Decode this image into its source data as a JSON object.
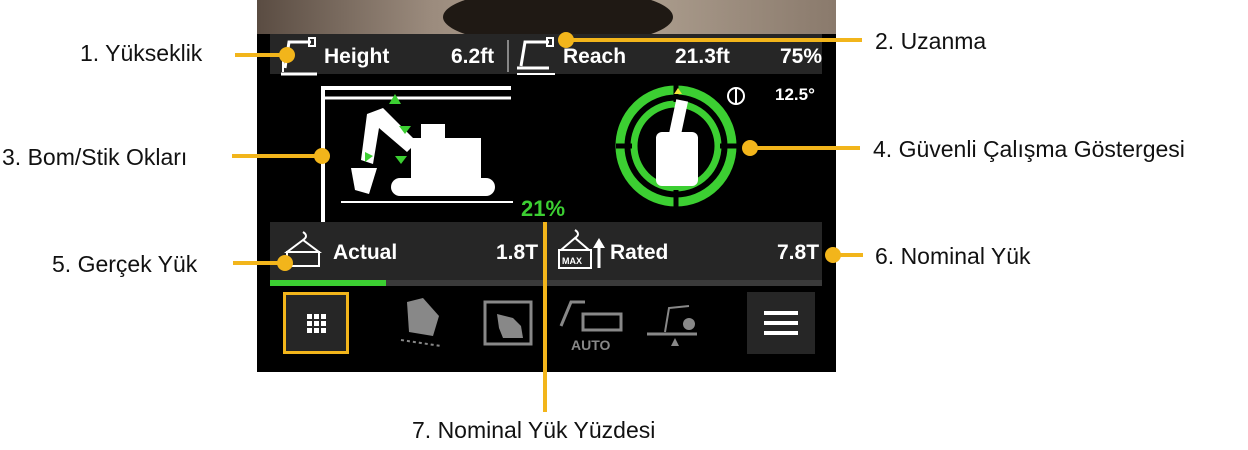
{
  "top_bar": {
    "height_label": "Height",
    "height_value": "6.2ft",
    "reach_label": "Reach",
    "reach_value": "21.3ft",
    "percent": "75%"
  },
  "gauge": {
    "angle": "12.5°"
  },
  "rated_percent_display": "21%",
  "load_bar": {
    "actual_label": "Actual",
    "actual_value": "1.8T",
    "rated_label": "Rated",
    "rated_value": "7.8T",
    "max_tag": "MAX",
    "progress": 0.21
  },
  "bottom_nav": {
    "auto_tag": "AUTO"
  },
  "callouts": {
    "c1": "1. Yükseklik",
    "c2": "2. Uzanma",
    "c3": "3. Bom/Stik Okları",
    "c4": "4. Güvenli Çalışma Göstergesi",
    "c5": "5. Gerçek Yük",
    "c6": "6. Nominal Yük",
    "c7": "7. Nominal Yük Yüzdesi"
  },
  "colors": {
    "accent": "#f2b51b",
    "safe_green": "#3ccf32",
    "panel": "#262626"
  }
}
